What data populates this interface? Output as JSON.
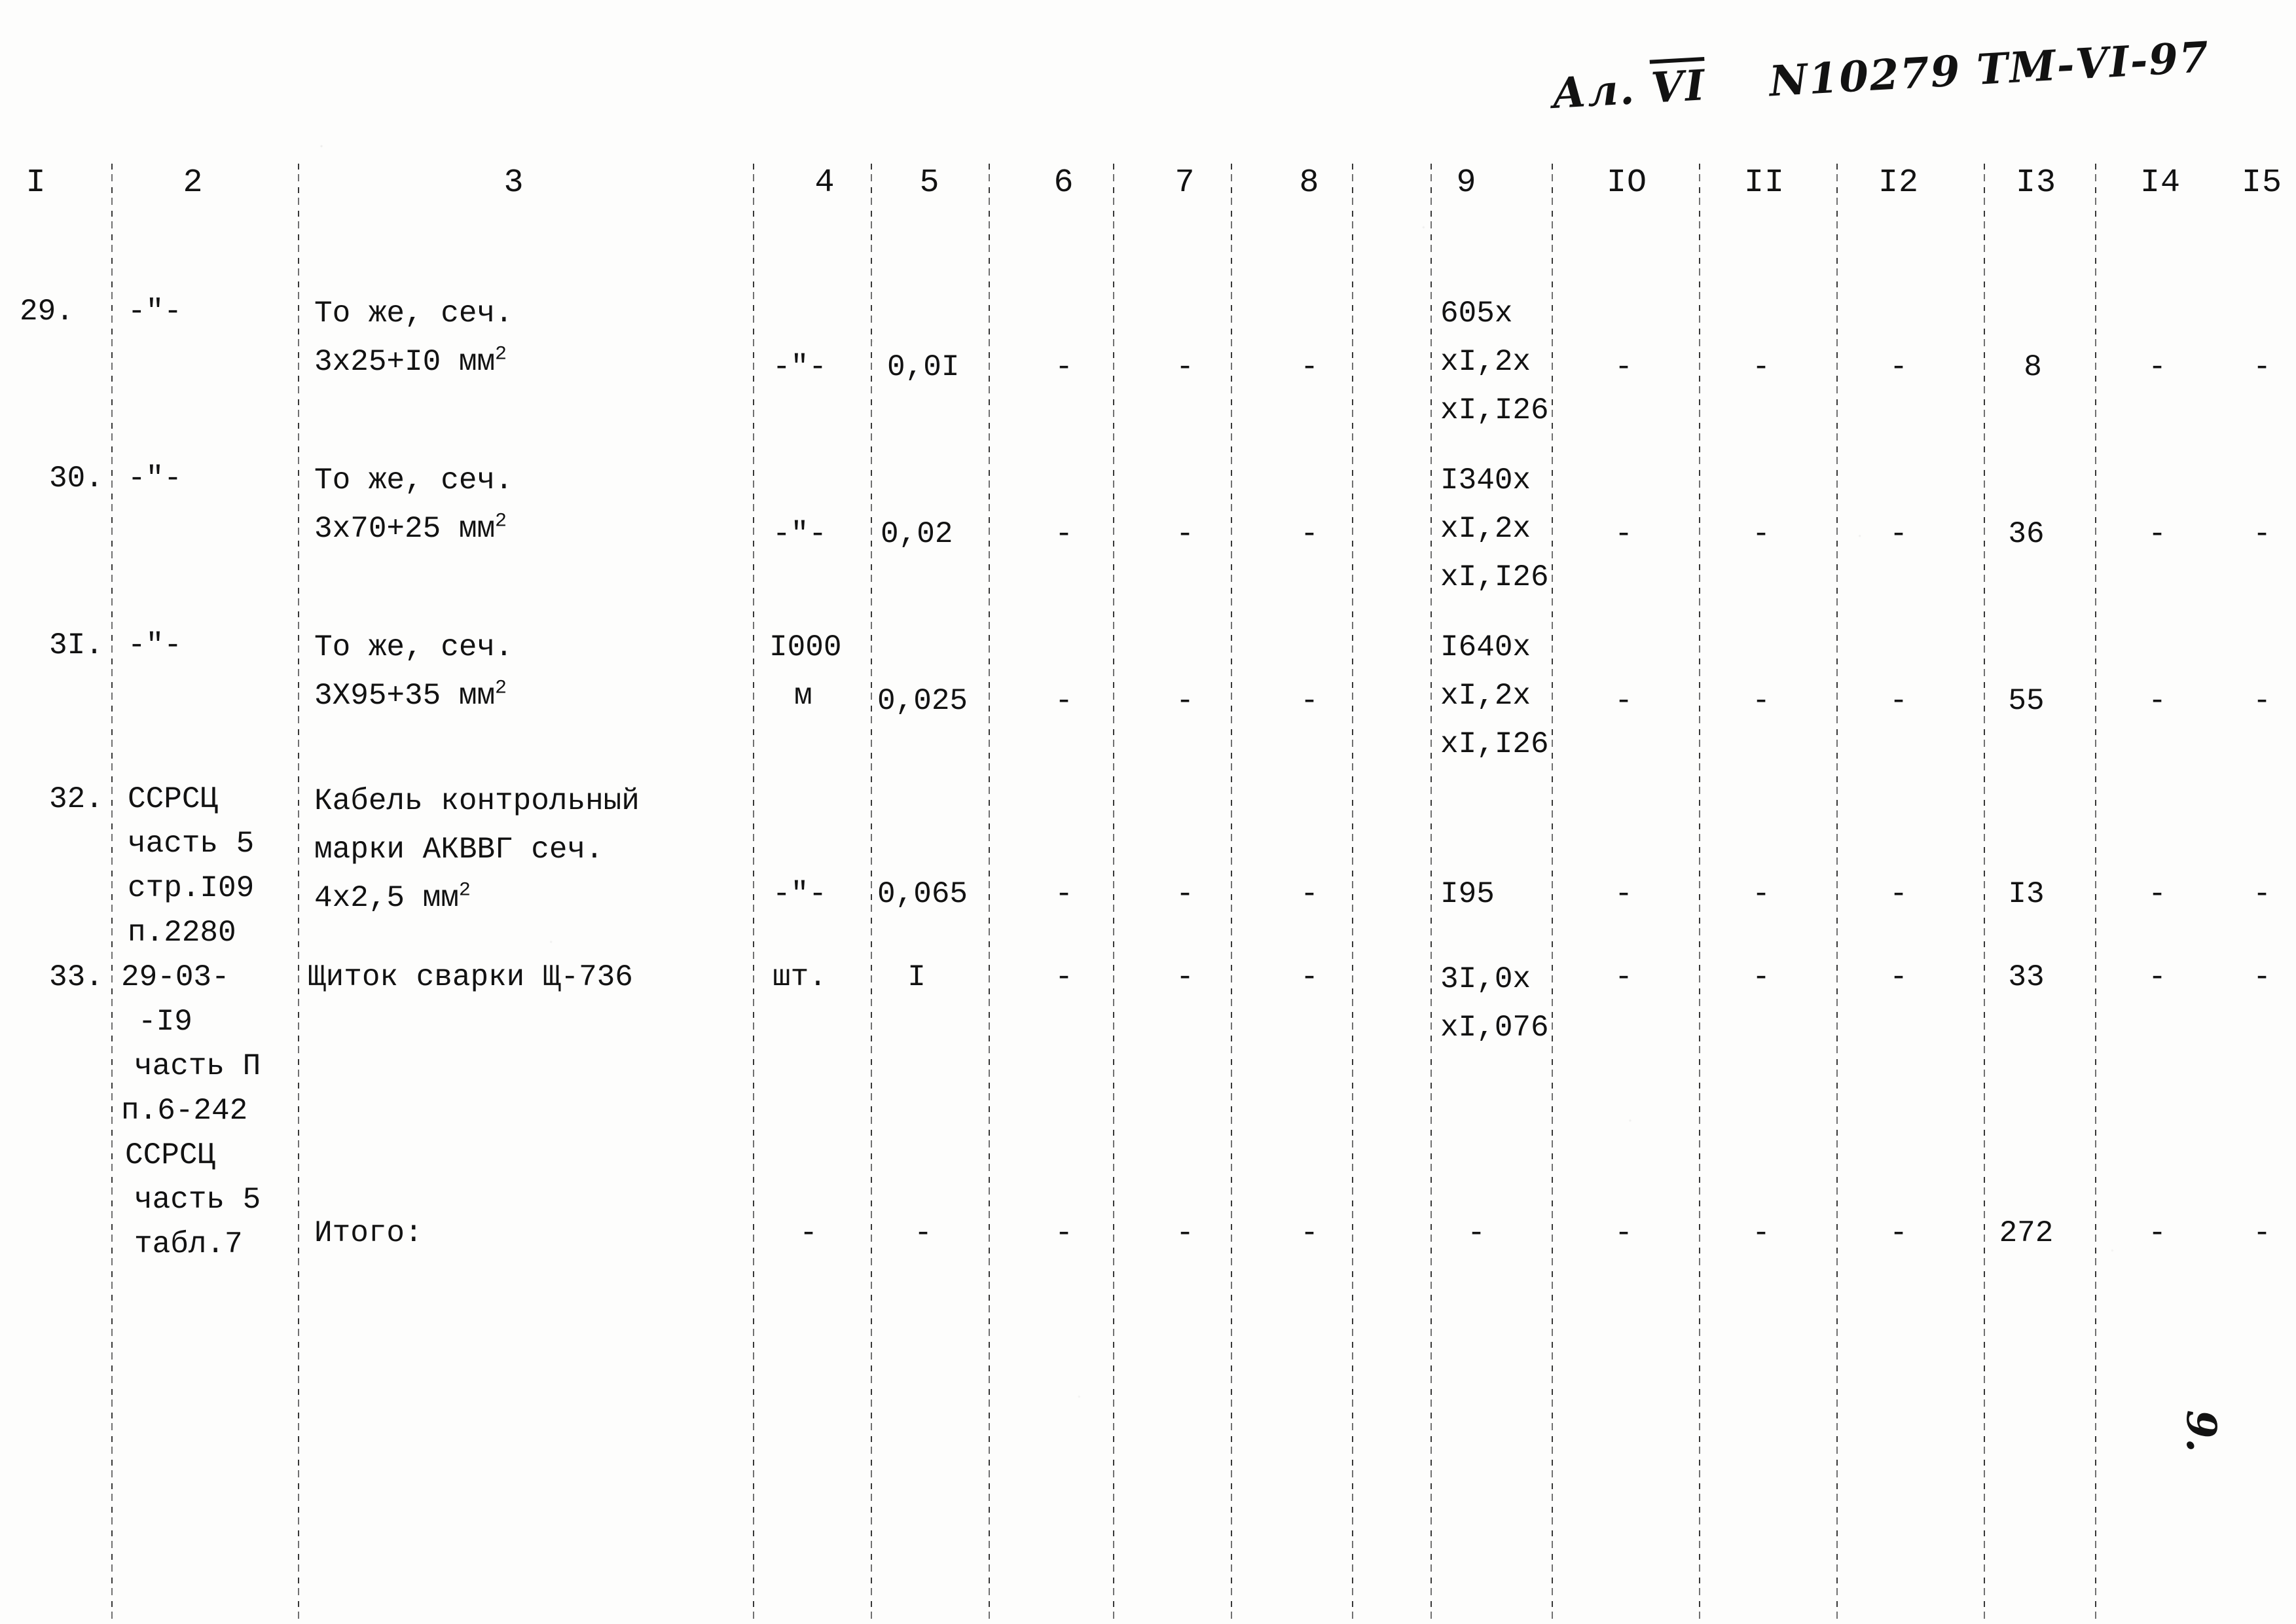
{
  "document": {
    "handwritten_header": {
      "album": "Ал.",
      "album_roman": "VI",
      "code": "N10279 ТМ-VI-97"
    },
    "page_number": "9."
  },
  "table": {
    "column_headers": [
      "I",
      "2",
      "3",
      "4",
      "5",
      "6",
      "7",
      "8",
      "9",
      "IO",
      "II",
      "I2",
      "I3",
      "I4",
      "I5"
    ],
    "rows": [
      {
        "c1": "29.",
        "c2": "-\"-",
        "c3_line1": "То же, сеч.",
        "c3_line2": "3х25+I0 мм",
        "c3_sup": "2",
        "c4": "-\"-",
        "c5": "0,0I",
        "c6": "-",
        "c7": "-",
        "c8": "-",
        "c9_line1": "605х",
        "c9_line2": "хI,2х",
        "c9_line3": "хI,I26",
        "c10": "-",
        "c11": "-",
        "c12": "-",
        "c13": "8",
        "c14": "-",
        "c15": "-"
      },
      {
        "c1": "30.",
        "c2": "-\"-",
        "c3_line1": "То же, сеч.",
        "c3_line2": "3х70+25 мм",
        "c3_sup": "2",
        "c4": "-\"-",
        "c5": "0,02",
        "c6": "-",
        "c7": "-",
        "c8": "-",
        "c9_line1": "I340х",
        "c9_line2": "хI,2х",
        "c9_line3": "хI,I26",
        "c10": "-",
        "c11": "-",
        "c12": "-",
        "c13": "36",
        "c14": "-",
        "c15": "-"
      },
      {
        "c1": "3I.",
        "c2": "-\"-",
        "c3_line1": "То же, сеч.",
        "c3_line2": "3Х95+35 мм",
        "c3_sup": "2",
        "c4_line1": "I000",
        "c4_line2": "м",
        "c5": "0,025",
        "c6": "-",
        "c7": "-",
        "c8": "-",
        "c9_line1": "I640х",
        "c9_line2": "хI,2х",
        "c9_line3": "хI,I26",
        "c10": "-",
        "c11": "-",
        "c12": "-",
        "c13": "55",
        "c14": "-",
        "c15": "-"
      },
      {
        "c1": "32.",
        "c2_line1": "ССРСЦ",
        "c2_line2": "часть 5",
        "c2_line3": "стр.I09",
        "c2_line4": "п.2280",
        "c3_line1": "Кабель контрольный",
        "c3_line2": "марки АКВВГ сеч.",
        "c3_line3": "4х2,5 мм",
        "c3_sup": "2",
        "c4": "-\"-",
        "c5": "0,065",
        "c6": "-",
        "c7": "-",
        "c8": "-",
        "c9": "I95",
        "c10": "-",
        "c11": "-",
        "c12": "-",
        "c13": "I3",
        "c14": "-",
        "c15": "-"
      },
      {
        "c1": "33.",
        "c2_line1": "29-03-",
        "c2_line2": "-I9",
        "c2_line3": "часть П",
        "c2_line4": "п.6-242",
        "c2_line5": "ССРСЦ",
        "c2_line6": "часть 5",
        "c2_line7": "табл.7",
        "c3_line1": "Щиток сварки Щ-736",
        "c4": "шт.",
        "c5": "I",
        "c6": "-",
        "c7": "-",
        "c8": "-",
        "c9_line1": "3I,0х",
        "c9_line2": "хI,076",
        "c10": "-",
        "c11": "-",
        "c12": "-",
        "c13": "33",
        "c14": "-",
        "c15": "-"
      }
    ],
    "total_row": {
      "label": "Итого:",
      "c4": "-",
      "c5": "-",
      "c6": "-",
      "c7": "-",
      "c8": "-",
      "c9": "-",
      "c10": "-",
      "c11": "-",
      "c12": "-",
      "c13": "272",
      "c14": "-",
      "c15": "-"
    }
  }
}
